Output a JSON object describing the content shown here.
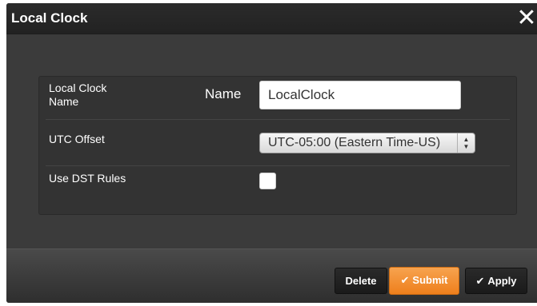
{
  "dialog": {
    "title": "Local Clock",
    "close_glyph": "✕"
  },
  "form": {
    "rows": [
      {
        "label": "Local Clock Name"
      },
      {
        "label": "UTC Offset"
      },
      {
        "label": "Use DST Rules"
      }
    ],
    "name_label": "Name",
    "name_value": "LocalClock",
    "utc_offset_value": "UTC-05:00 (Eastern Time-US)",
    "dst_checked": false
  },
  "footer": {
    "delete_label": "Delete",
    "submit_label": "Submit",
    "apply_label": "Apply",
    "check_glyph": "✔"
  },
  "colors": {
    "dialog_bg": "#3a3a3a",
    "title_bar": "#222222",
    "submit_accent": "#f08a2a"
  },
  "icons": {
    "close": "close-icon",
    "select_arrows": "select-arrows-icon",
    "submit_check": "checkmark-icon",
    "apply_check": "checkmark-icon"
  }
}
